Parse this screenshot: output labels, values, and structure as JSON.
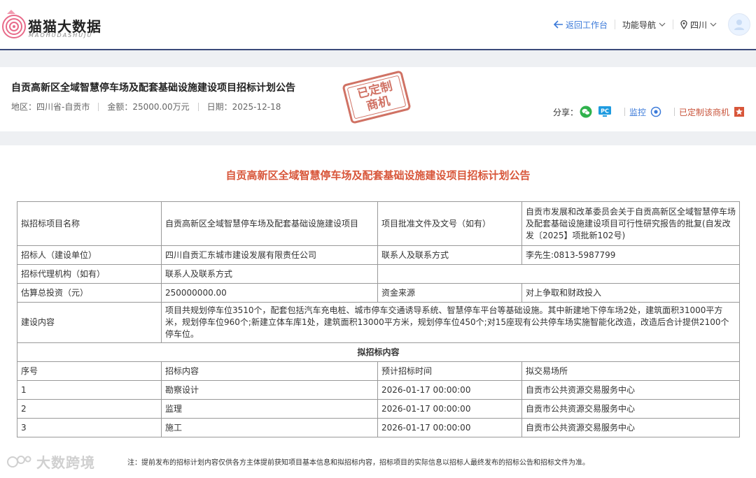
{
  "brand": {
    "name_cn": "猫猫大数据",
    "name_en": "MAOHUDASHUJU"
  },
  "nav": {
    "back_label": "返回工作台",
    "func_nav_label": "功能导航",
    "region_label": "四川"
  },
  "header": {
    "title": "自贡高新区全域智慧停车场及配套基础设施建设项目招标计划公告",
    "region": "地区：四川省-自贡市",
    "amount": "金额：25000.00万元",
    "date": "日期：2025-12-18",
    "stamp_line1": "已定制",
    "stamp_line2": "商机",
    "share_label": "分享：",
    "monitor_label": "监控",
    "customized_label": "已定制该商机"
  },
  "main": {
    "title": "自贡高新区全域智慧停车场及配套基础设施建设项目招标计划公告",
    "rows": {
      "project_name_label": "拟招标项目名称",
      "project_name_value": "自贡高新区全域智慧停车场及配套基础设施建设项目",
      "approval_label": "项目批准文件及文号（如有）",
      "approval_value": "自贡市发展和改革委员会关于自贡高新区全域智慧停车场及配套基础设施建设项目可行性研究报告的批复(自发改发〔2025】项批新102号)",
      "tenderer_label": "招标人（建设单位）",
      "tenderer_value": "四川自贡汇东城市建设发展有限责任公司",
      "contact_label": "联系人及联系方式",
      "contact_value": "李先生:0813-5987799",
      "agency_label": "招标代理机构（如有）",
      "agency_contact_label": "联系人及联系方式",
      "investment_label": "估算总投资（元）",
      "investment_value": "250000000.00",
      "fund_label": "资金来源",
      "fund_value": "对上争取和财政投入",
      "content_label": "建设内容",
      "content_value": "项目共规划停车位3510个，配套包括汽车充电桩、城市停车交通诱导系统、智慧停车平台等基础设施。其中新建地下停车场2处，建筑面积31000平方米，规划停车位960个;新建立体车库1处，建筑面积13000平方米，规划停车位450个;对15座现有公共停车场实施智能化改造，改造后合计提供2100个停车位。",
      "section_label": "拟招标内容"
    },
    "sub_headers": [
      "序号",
      "招标内容",
      "预计招标时间",
      "拟交易场所"
    ],
    "items": [
      {
        "no": "1",
        "content": "勘察设计",
        "time": "2026-01-17 00:00:00",
        "place": "自贡市公共资源交易服务中心"
      },
      {
        "no": "2",
        "content": "监理",
        "time": "2026-01-17 00:00:00",
        "place": "自贡市公共资源交易服务中心"
      },
      {
        "no": "3",
        "content": "施工",
        "time": "2026-01-17 00:00:00",
        "place": "自贡市公共资源交易服务中心"
      }
    ],
    "note": "注：提前发布的招标计划内容仅供各方主体提前获知项目基本信息和拟招标内容，招标项目的实际信息以招标人最终发布的招标公告和招标文件为准。"
  },
  "watermark": "大数跨境",
  "colors": {
    "accent_blue": "#3b7ad9",
    "title_red": "#d8563a",
    "stamp_red": "#c85a4a",
    "nav_border": "#3a4a7a"
  }
}
